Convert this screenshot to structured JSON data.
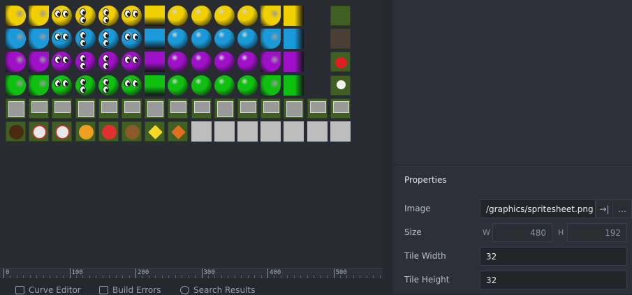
{
  "colors": {
    "yellow": "#f0d000",
    "blue": "#1a9ad8",
    "purple": "#a010c8",
    "green": "#10c010",
    "grass": "#3f5f23",
    "gray_block": "#9a9a9a",
    "light_tile": "#bdbdbd"
  },
  "ruler": {
    "labels": [
      "0",
      "100",
      "200",
      "300",
      "400",
      "500"
    ]
  },
  "bottom_tabs": [
    {
      "label": "Curve Editor",
      "icon": "curve-icon"
    },
    {
      "label": "Build Errors",
      "icon": "build-errors-icon"
    },
    {
      "label": "Search Results",
      "icon": "search-icon"
    }
  ],
  "properties": {
    "title": "Properties",
    "image_label": "Image",
    "image_value": "/graphics/spritesheet.png",
    "goto_icon": "→|",
    "browse_icon": "…",
    "size_label": "Size",
    "w_label": "W",
    "w_value": "480",
    "h_label": "H",
    "h_value": "192",
    "tile_width_label": "Tile Width",
    "tile_width_value": "32",
    "tile_height_label": "Tile Height",
    "tile_height_value": "32"
  }
}
